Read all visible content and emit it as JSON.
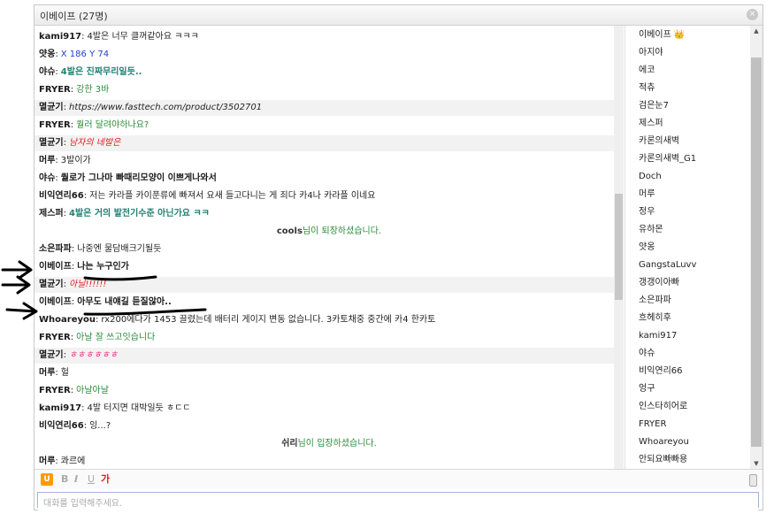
{
  "window": {
    "title": "이베이프 (27명)",
    "close_symbol": "×"
  },
  "messages": [
    {
      "type": "msg",
      "nick": "kami917",
      "text": "4발은 너무 클꺼같아요 ㅋㅋㅋ",
      "style": "c-dark",
      "shade": false
    },
    {
      "type": "msg",
      "nick": "얏옹",
      "text": "X 186 Y 74",
      "style": "c-blue",
      "shade": false
    },
    {
      "type": "msg",
      "nick": "야슈",
      "text": "4발은 진짜무리일듯..",
      "style": "c-teal-bold",
      "shade": false
    },
    {
      "type": "msg",
      "nick": "FRYER",
      "text": "강한 3바",
      "style": "c-green",
      "shade": false
    },
    {
      "type": "msg",
      "nick": "멸균기",
      "text": "https://www.fasttech.com/product/3502701",
      "style": "c-it",
      "shade": true
    },
    {
      "type": "msg",
      "nick": "FRYER",
      "text": "퀄러 달려야하나요?",
      "style": "c-green",
      "shade": false
    },
    {
      "type": "msg",
      "nick": "멸균기",
      "text": "남자의 네발은",
      "style": "c-red-it",
      "shade": true
    },
    {
      "type": "msg",
      "nick": "머루",
      "text": "3발이가",
      "style": "c-dark",
      "shade": false
    },
    {
      "type": "msg",
      "nick": "야슈",
      "text": "퀄로가 그나마 빠때리모양이 이쁘게나와서",
      "style": "c-bold",
      "shade": false
    },
    {
      "type": "msg",
      "nick": "비익연리66",
      "text": "저는 카라플 카이푼류에 빠져서 요새 들고다니는 게 죄다 카4나 카라플 이네요",
      "style": "c-dark",
      "shade": false
    },
    {
      "type": "msg",
      "nick": "제스퍼",
      "text": "4발은 거의 발전기수준 아닌가요 ㅋㅋ",
      "style": "c-teal-bold",
      "shade": false
    },
    {
      "type": "sys",
      "nick": "cools",
      "text": "님이 퇴장하셨습니다."
    },
    {
      "type": "msg",
      "nick": "소은파파",
      "text": "나중엔 물담배크기될듯",
      "style": "c-dark",
      "shade": false
    },
    {
      "type": "msg",
      "nick": "이베이프",
      "text": "나는 누구인가",
      "style": "c-underline",
      "shade": false
    },
    {
      "type": "msg",
      "nick": "멸균기",
      "text": "아닐!!!!!!",
      "style": "c-red-it",
      "shade": true
    },
    {
      "type": "msg",
      "nick": "이베이프",
      "text": "아무도 내얘길 듣질않아..",
      "style": "c-underline",
      "shade": false
    },
    {
      "type": "msg",
      "nick": "Whoareyou",
      "text": "rx200에다가 1453 끌렸는데 배터리 게이지 변동 없습니다. 3카토채중 중간에 카4 한카토",
      "style": "c-dark",
      "shade": false
    },
    {
      "type": "msg",
      "nick": "FRYER",
      "text": "아날 잘 쓰고잇습니다",
      "style": "c-green",
      "shade": false
    },
    {
      "type": "msg",
      "nick": "멸균기",
      "text": "ㅎㅎㅎㅎㅎㅎ",
      "style": "c-pink",
      "shade": true
    },
    {
      "type": "msg",
      "nick": "머루",
      "text": "헐",
      "style": "c-dark",
      "shade": false
    },
    {
      "type": "msg",
      "nick": "FRYER",
      "text": "아날아날",
      "style": "c-green",
      "shade": false
    },
    {
      "type": "msg",
      "nick": "kami917",
      "text": "4발 터지면 대박일듯 ㅎㄷㄷ",
      "style": "c-dark",
      "shade": false
    },
    {
      "type": "msg",
      "nick": "비익연리66",
      "text": "잉...?",
      "style": "c-dark",
      "shade": false
    },
    {
      "type": "sys",
      "nick": "쉬리",
      "text": "님이 입장하셨습니다."
    },
    {
      "type": "msg",
      "nick": "머루",
      "text": "콰르에",
      "style": "c-dark",
      "shade": false
    }
  ],
  "users": [
    {
      "name": "이베이프",
      "crown": true
    },
    {
      "name": "아지야"
    },
    {
      "name": "에코"
    },
    {
      "name": "적츄"
    },
    {
      "name": "검은눈7"
    },
    {
      "name": "제스퍼"
    },
    {
      "name": "카론의새벽"
    },
    {
      "name": "카론의새벽_G1"
    },
    {
      "name": "Doch"
    },
    {
      "name": "머루"
    },
    {
      "name": "정우"
    },
    {
      "name": "유하몬"
    },
    {
      "name": "얏옹"
    },
    {
      "name": "GangstaLuvv"
    },
    {
      "name": "갱갱이아빠"
    },
    {
      "name": "소은파파"
    },
    {
      "name": "흐헤히후"
    },
    {
      "name": "kami917"
    },
    {
      "name": "야슈"
    },
    {
      "name": "비익연리66"
    },
    {
      "name": "엉구"
    },
    {
      "name": "인스타히어로"
    },
    {
      "name": "FRYER"
    },
    {
      "name": "Whoareyou"
    },
    {
      "name": "안되요빠빠용"
    }
  ],
  "crown_symbol": "👑",
  "toolbar": {
    "power": "U",
    "bold": "B",
    "italic": "I",
    "underline": "U",
    "color": "가"
  },
  "input": {
    "placeholder": "대화를 입력해주세요.",
    "value": ""
  }
}
